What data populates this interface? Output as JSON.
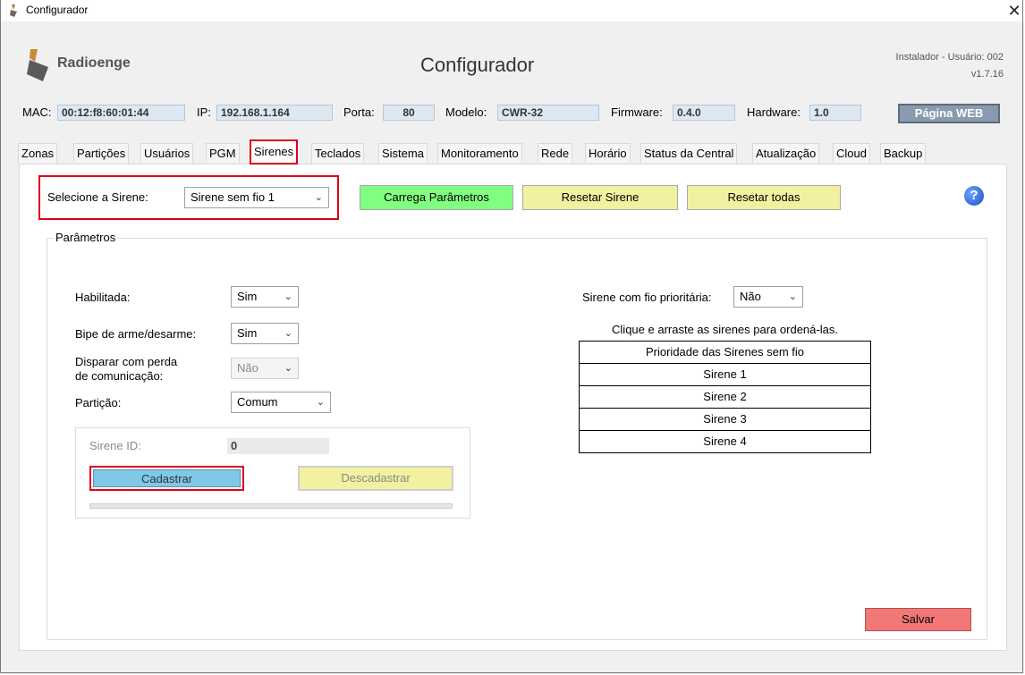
{
  "window": {
    "title": "Configurador",
    "close_glyph": "✕"
  },
  "header": {
    "brand": "Radioenge",
    "title": "Configurador",
    "user_line": "Instalador - Usuário:  002",
    "version": "v1.7.16"
  },
  "device": {
    "mac_label": "MAC:",
    "mac": "00:12:f8:60:01:44",
    "ip_label": "IP:",
    "ip": "192.168.1.164",
    "port_label": "Porta:",
    "port": "80",
    "model_label": "Modelo:",
    "model": "CWR-32",
    "firmware_label": "Firmware:",
    "firmware": "0.4.0",
    "hardware_label": "Hardware:",
    "hardware": "1.0",
    "web_button": "Página WEB"
  },
  "tabs": [
    {
      "label": "Zonas"
    },
    {
      "label": "Partições"
    },
    {
      "label": "Usuários"
    },
    {
      "label": "PGM"
    },
    {
      "label": "Sirenes",
      "selected": true
    },
    {
      "label": "Teclados"
    },
    {
      "label": "Sistema"
    },
    {
      "label": "Monitoramento"
    },
    {
      "label": "Rede"
    },
    {
      "label": "Horário"
    },
    {
      "label": "Status da Central"
    },
    {
      "label": "Atualização"
    },
    {
      "label": "Cloud"
    },
    {
      "label": "Backup"
    }
  ],
  "toolbar": {
    "select_label": "Selecione a Sirene:",
    "select_value": "Sirene sem fio 1",
    "load_button": "Carrega Parâmetros",
    "reset_button": "Resetar Sirene",
    "reset_all_button": "Resetar todas",
    "help_glyph": "?"
  },
  "params": {
    "group_title": "Parâmetros",
    "habilitada_label": "Habilitada:",
    "habilitada_value": "Sim",
    "bipe_label": "Bipe de arme/desarme:",
    "bipe_value": "Sim",
    "disparar_label_1": "Disparar com perda",
    "disparar_label_2": "de comunicação:",
    "disparar_value": "Não",
    "particao_label": "Partição:",
    "particao_value": "Comum",
    "sirene_id_label": "Sirene ID:",
    "sirene_id_value": "0",
    "cadastrar_button": "Cadastrar",
    "descadastrar_button": "Descadastrar",
    "prioritaria_label": "Sirene com fio prioritária:",
    "prioritaria_value": "Não",
    "drag_hint": "Clique e arraste as sirenes para ordená-las.",
    "priority_header": "Prioridade das Sirenes sem fio",
    "priority_items": [
      "Sirene 1",
      "Sirene 2",
      "Sirene 3",
      "Sirene 4"
    ],
    "save_button": "Salvar"
  },
  "colors": {
    "highlight_red": "#e00018",
    "load_green": "#80ff80",
    "reset_yellow": "#f1f1a0",
    "cadastrar_blue": "#80c8e8",
    "salvar_red": "#f27878"
  }
}
